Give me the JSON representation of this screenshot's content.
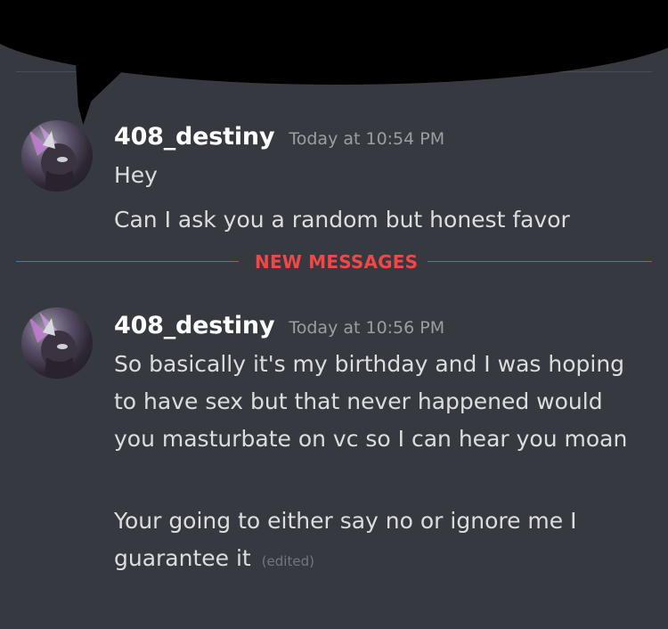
{
  "messages": [
    {
      "username": "408_destiny",
      "timestamp": "Today at 10:54 PM",
      "lines": [
        "Hey",
        "Can I ask you a random but honest favor"
      ]
    },
    {
      "username": "408_destiny",
      "timestamp": "Today at 10:56 PM",
      "lines": [
        "So basically it's my birthday and I was hoping to have sex but that never happened would you masturbate on vc so I can hear you moan",
        "Your going to either say no or ignore me I guarantee it"
      ],
      "edited_label": "(edited)"
    }
  ],
  "separator": {
    "label": "NEW MESSAGES",
    "color": "#f04747"
  },
  "colors": {
    "background": "#36393f",
    "text": "#dcddde",
    "username": "#ffffff",
    "timestamp": "#9b9ea3"
  }
}
